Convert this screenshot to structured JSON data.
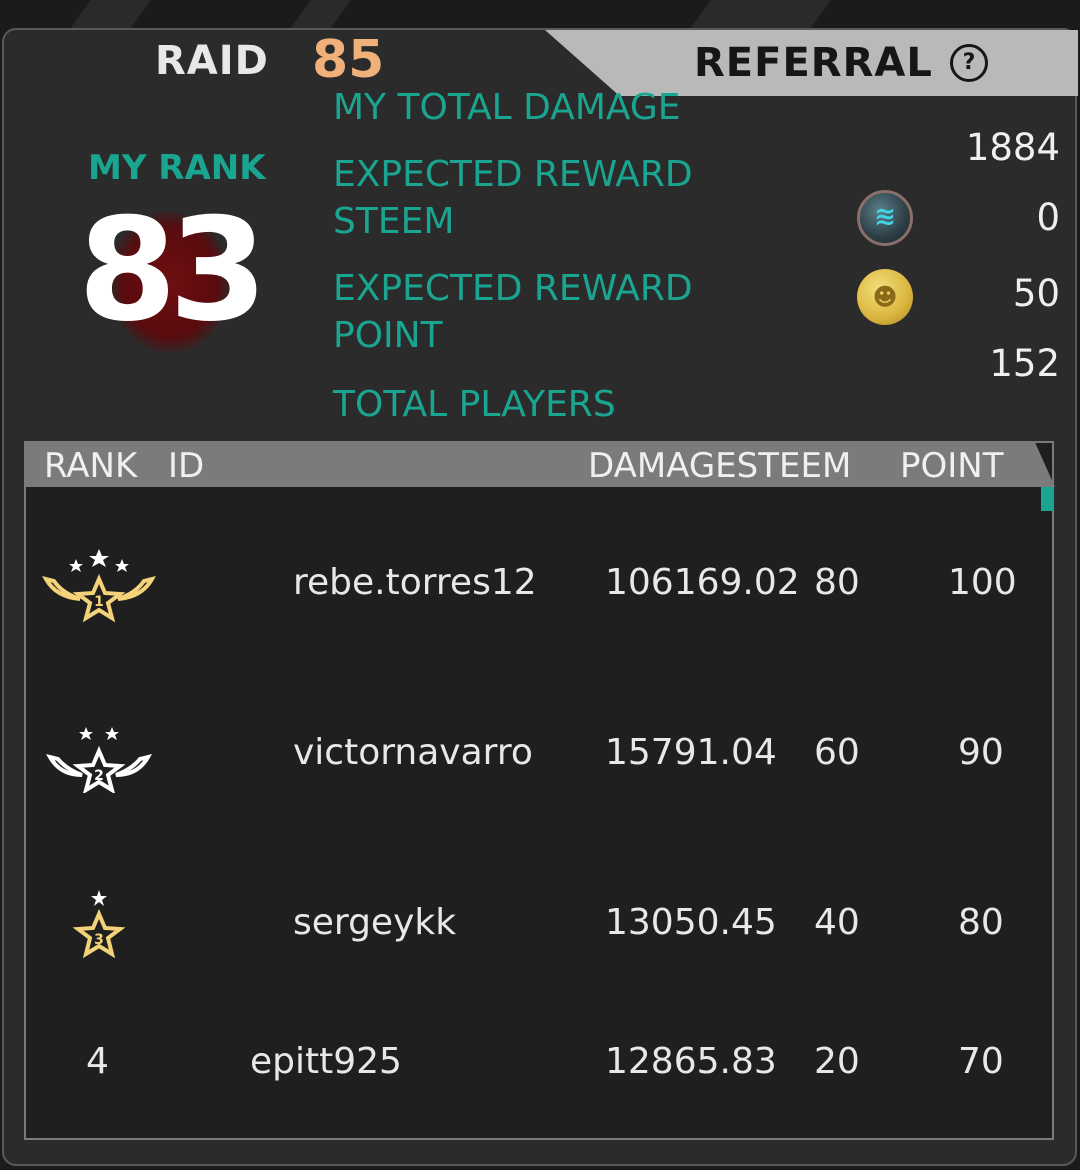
{
  "tabs": {
    "raid_label": "RAID",
    "raid_count": "85",
    "referral_label": "REFERRAL",
    "help_icon": "question-circle-icon"
  },
  "my_rank": {
    "label": "MY RANK",
    "value": "83"
  },
  "stats": {
    "total_damage_label": "MY TOTAL DAMAGE",
    "total_damage_value": "1884",
    "reward_steem_label_1": "EXPECTED REWARD",
    "reward_steem_label_2": "STEEM",
    "reward_steem_value": "0",
    "reward_steem_icon": "steem-coin-icon",
    "reward_point_label_1": "EXPECTED REWARD",
    "reward_point_label_2": "POINT",
    "reward_point_value": "50",
    "reward_point_icon": "gold-point-coin-icon",
    "total_players_label": "TOTAL PLAYERS",
    "total_players_value": "152"
  },
  "table": {
    "headers": {
      "rank": "RANK",
      "id": "ID",
      "damage": "DAMAGESTEEM",
      "point": "POINT"
    },
    "rows": [
      {
        "rank_icon": "rank-1-gold-medal-icon",
        "rank": "1",
        "id": "rebe.torres12",
        "damage": "106169.02",
        "steem": "80",
        "point": "100"
      },
      {
        "rank_icon": "rank-2-silver-medal-icon",
        "rank": "2",
        "id": "victornavarro",
        "damage": "15791.04",
        "steem": "60",
        "point": "90"
      },
      {
        "rank_icon": "rank-3-bronze-medal-icon",
        "rank": "3",
        "id": "sergeykk",
        "damage": "13050.45",
        "steem": "40",
        "point": "80"
      },
      {
        "rank_icon": "",
        "rank": "4",
        "id": "epitt925",
        "damage": "12865.83",
        "steem": "20",
        "point": "70"
      }
    ]
  },
  "colors": {
    "accent_teal": "#1aa591",
    "raid_count": "#f0b07a",
    "gold_medal": "#f3d27a",
    "silver_medal": "#ffffff"
  }
}
